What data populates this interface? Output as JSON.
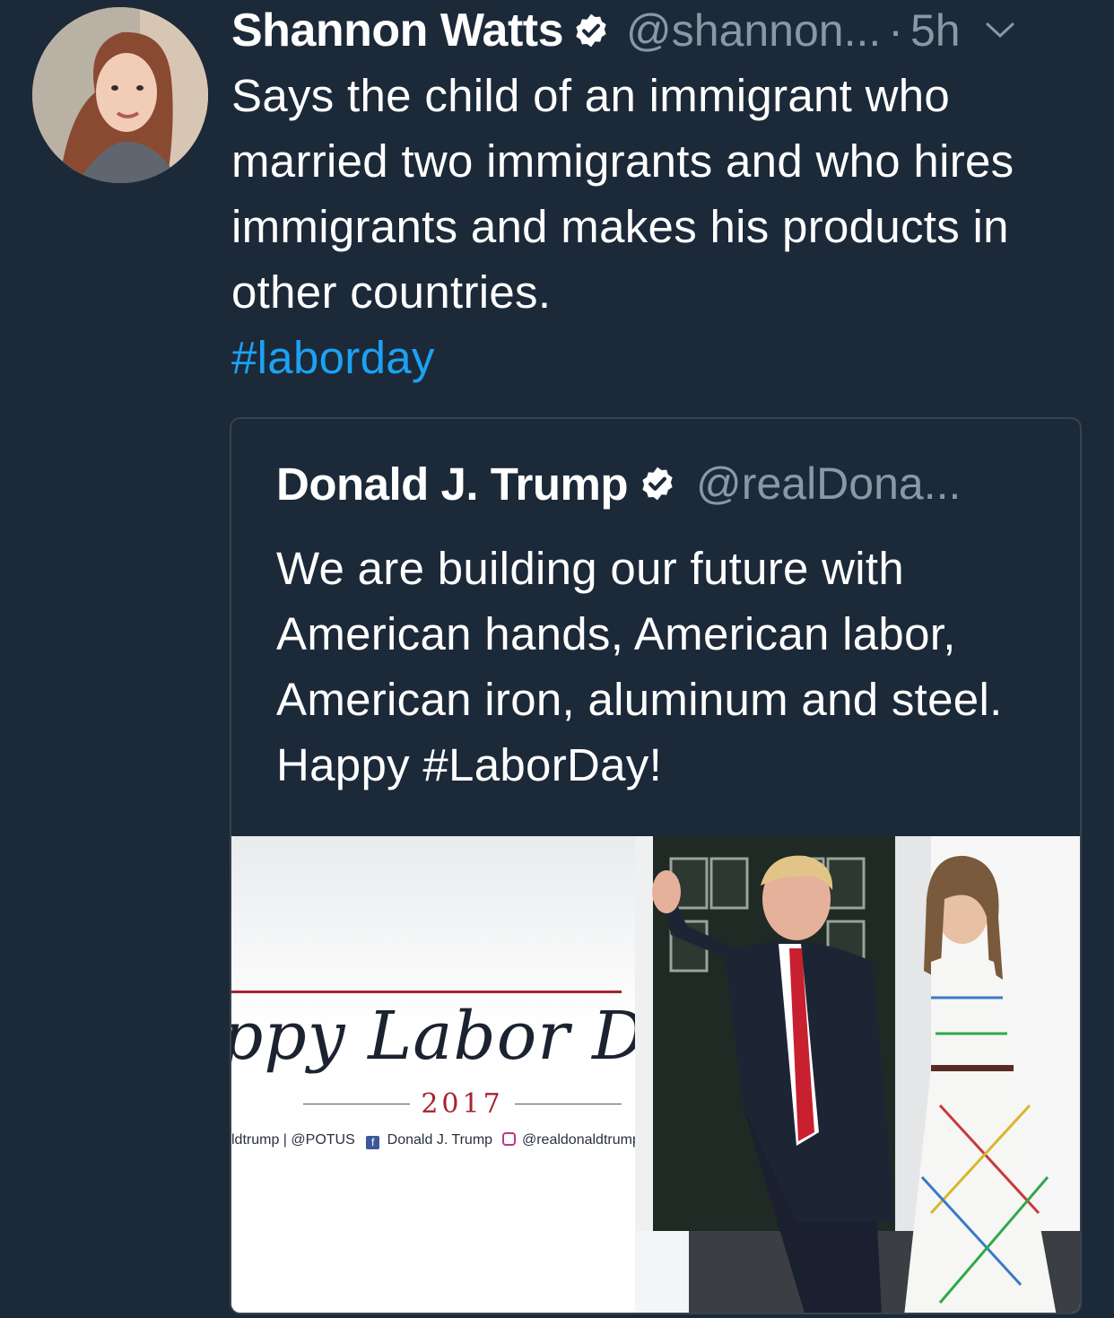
{
  "tweet": {
    "author_name": "Shannon Watts",
    "handle": "@shannon...",
    "separator": "·",
    "time": "5h",
    "text": "Says the child of an immigrant who married two immigrants and who hires immigrants and makes his products in other countries.",
    "hashtag": "#laborday"
  },
  "quoted_tweet": {
    "author_name": "Donald J. Trump",
    "handle": "@realDona...",
    "text": "We are building our future with American hands, American labor, American iron, aluminum and steel. Happy #LaborDay!",
    "image": {
      "banner_title": "ppy Labor Day",
      "banner_year": "2017",
      "social_prefix": "ldtrump | @POTUS",
      "social_facebook": "Donald J. Trump",
      "social_instagram": "@realdonaldtrump"
    }
  },
  "colors": {
    "background": "#1c2938",
    "text": "#ffffff",
    "secondary": "#8899a6",
    "link": "#1da1f2",
    "border": "#38444d"
  },
  "icons": [
    "verified-badge-icon",
    "chevron-down-icon",
    "facebook-icon",
    "instagram-icon"
  ]
}
